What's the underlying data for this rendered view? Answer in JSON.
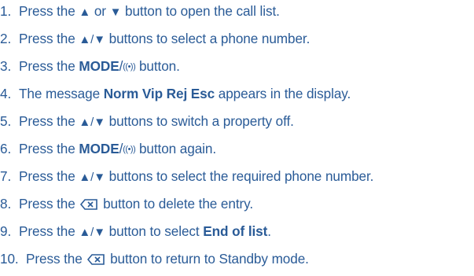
{
  "steps": [
    {
      "num": "1.",
      "a": "Press the ",
      "up": "▲",
      "or": " or ",
      "down": "▼",
      "rest": " button to open the call list."
    },
    {
      "num": "2.",
      "a": "Press the ",
      "updown": "▲/▼",
      "rest": " buttons to select a phone number."
    },
    {
      "num": "3.",
      "a": "Press the ",
      "mode": "MODE",
      "slash": "/",
      "radio": "((•))",
      "rest": " button."
    },
    {
      "num": "4.",
      "a": "The message ",
      "bold": "Norm Vip Rej Esc",
      "rest": " appears in the display."
    },
    {
      "num": "5.",
      "a": "Press the ",
      "updown": "▲/▼",
      "rest": " buttons to switch a property off."
    },
    {
      "num": "6.",
      "a": "Press the ",
      "mode": "MODE",
      "slash": "/",
      "radio": "((•))",
      "rest": " button again."
    },
    {
      "num": "7.",
      "a": "Press the ",
      "updown": "▲/▼",
      "rest": " buttons to select the required phone number."
    },
    {
      "num": "8.",
      "a": "Press the ",
      "rest": " button to delete the entry."
    },
    {
      "num": "9.",
      "a": "Press the ",
      "updown": "▲/▼",
      "mid": " button to select ",
      "bold": "End of list",
      "end": "."
    },
    {
      "num": "10.",
      "a": "Press the ",
      "rest": " button to return to Standby mode."
    }
  ],
  "icons": {
    "delete_key": "backspace-delete-icon",
    "ring_mode": "ring-mode-icon"
  },
  "colors": {
    "text": "#2a5b97"
  }
}
